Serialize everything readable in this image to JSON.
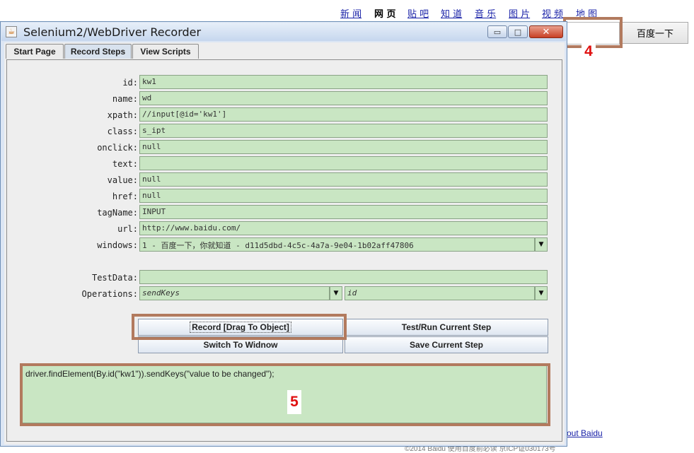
{
  "background_page": {
    "nav": [
      "新 闻",
      "网 页",
      "贴 吧",
      "知 道",
      "音 乐",
      "图 片",
      "视 频",
      "地 图"
    ],
    "search_button": "百度一下",
    "about_link": "out  Baidu",
    "footer": "©2014 Baidu 使用百度前必读 京ICP证030173号"
  },
  "annotations": {
    "four": "4",
    "five": "5"
  },
  "window": {
    "title": "Selenium2/WebDriver Recorder",
    "controls": {
      "minimize": "▭",
      "maximize": "□",
      "close": "✕"
    },
    "tabs": [
      "Start Page",
      "Record Steps",
      "View Scripts"
    ],
    "active_tab": "Record Steps",
    "fields": {
      "id": {
        "label": "id:",
        "value": "kw1"
      },
      "name": {
        "label": "name:",
        "value": "wd"
      },
      "xpath": {
        "label": "xpath:",
        "value": "//input[@id='kw1']"
      },
      "class": {
        "label": "class:",
        "value": "s_ipt"
      },
      "onclick": {
        "label": "onclick:",
        "value": "null"
      },
      "text": {
        "label": "text:",
        "value": ""
      },
      "value": {
        "label": "value:",
        "value": "null"
      },
      "href": {
        "label": "href:",
        "value": "null"
      },
      "tagName": {
        "label": "tagName:",
        "value": "INPUT"
      },
      "url": {
        "label": "url:",
        "value": "http://www.baidu.com/"
      },
      "windows": {
        "label": "windows:",
        "value": "1 - 百度一下，你就知道 - d11d5dbd-4c5c-4a7a-9e04-1b02aff47806"
      }
    },
    "testdata": {
      "label": "TestData:",
      "value": ""
    },
    "operations": {
      "label": "Operations:",
      "action": "sendKeys",
      "locator": "id"
    },
    "buttons": {
      "record": "Record [Drag To Object]",
      "test_run": "Test/Run Current Step",
      "switch_window": "Switch To Widnow",
      "save_step": "Save Current Step"
    },
    "code": "driver.findElement(By.id(\"kw1\")).sendKeys(\"value to be changed\");"
  }
}
